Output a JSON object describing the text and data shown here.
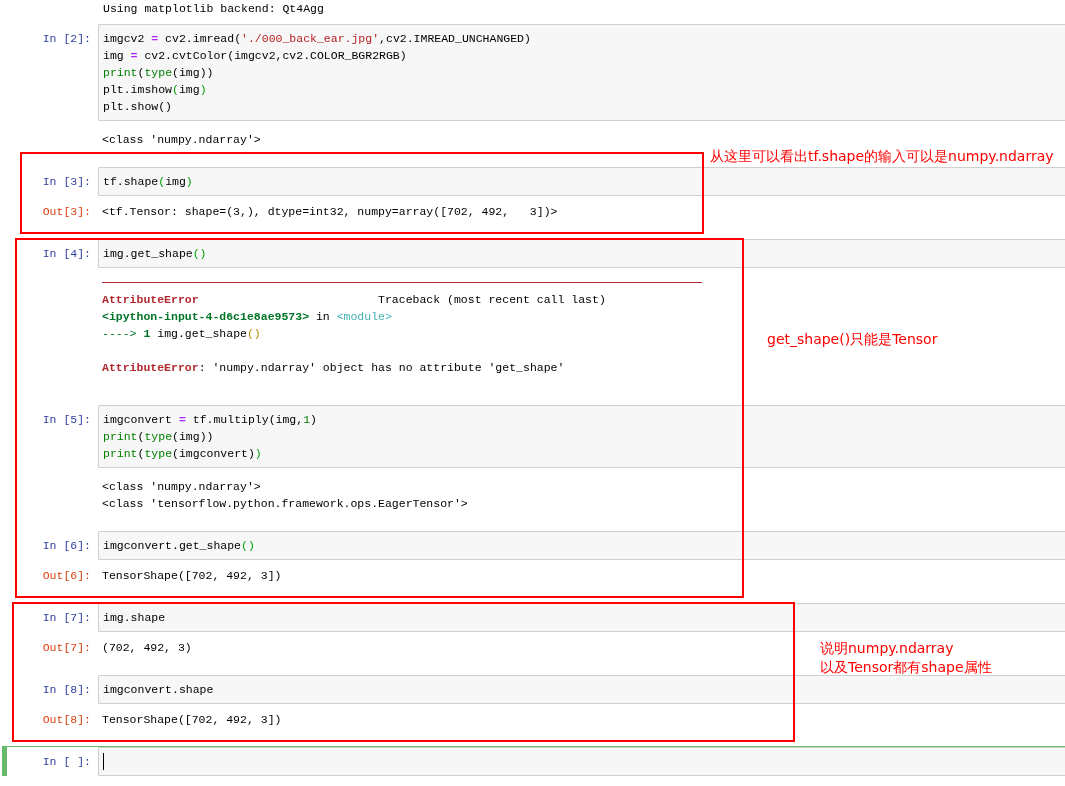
{
  "top_output": "Using matplotlib backend: Qt4Agg",
  "cells": [
    {
      "prompt": "In [2]:",
      "selected": false,
      "cursor": false,
      "code": [
        [
          {
            "text": "imgcv2 "
          },
          {
            "text": "=",
            "kind": "op"
          },
          {
            "text": " cv2.imread("
          },
          {
            "text": "'./000_back_ear.jpg'",
            "kind": "str"
          },
          {
            "text": ",cv2.IMREAD_UNCHANGED)"
          }
        ],
        [
          {
            "text": "img "
          },
          {
            "text": "=",
            "kind": "op"
          },
          {
            "text": " cv2.cvtColor(imgcv2,cv2.COLOR_BGR2RGB)"
          }
        ],
        [
          {
            "text": "print",
            "kind": "builtin"
          },
          {
            "text": "("
          },
          {
            "text": "type",
            "kind": "builtin"
          },
          {
            "text": "(img))"
          }
        ],
        [
          {
            "text": "plt.imshow"
          },
          {
            "text": "(",
            "kind": "bracket"
          },
          {
            "text": "img"
          },
          {
            "text": ")",
            "kind": "bracket"
          }
        ],
        [
          {
            "text": "plt.show()"
          }
        ]
      ],
      "output": {
        "kind": "stream",
        "lines": [
          [
            {
              "text": "<class 'numpy.ndarray'>"
            }
          ]
        ]
      }
    },
    {
      "prompt": "In [3]:",
      "selected": false,
      "cursor": false,
      "code": [
        [
          {
            "text": "tf.shape"
          },
          {
            "text": "(",
            "kind": "bracket"
          },
          {
            "text": "img"
          },
          {
            "text": ")",
            "kind": "bracket"
          }
        ]
      ],
      "output": {
        "kind": "result",
        "prompt": "Out[3]:",
        "lines": [
          [
            {
              "text": "<tf.Tensor: shape=(3,), dtype=int32, numpy=array([702, 492,   3])>"
            }
          ]
        ]
      }
    },
    {
      "prompt": "In [4]:",
      "selected": false,
      "cursor": false,
      "code": [
        [
          {
            "text": "img.get_shape"
          },
          {
            "text": "()",
            "kind": "bracket"
          }
        ]
      ],
      "output": {
        "kind": "error",
        "lines": [
          [
            {
              "text": "AttributeError",
              "kind": "ename"
            },
            {
              "text": "                          Traceback (most recent call last)"
            }
          ],
          [
            {
              "text": "<ipython-input-4-d6c1e8ae9573>",
              "kind": "fn"
            },
            {
              "text": " in "
            },
            {
              "text": "<module>",
              "kind": "mod"
            }
          ],
          [
            {
              "text": "---->",
              "kind": "arrow"
            },
            {
              "text": " 1",
              "kind": "fn"
            },
            {
              "text": " img.get_shape"
            },
            {
              "text": "()",
              "kind": "paren"
            }
          ]
        ],
        "message": [
          {
            "text": "AttributeError",
            "kind": "ename"
          },
          {
            "text": ": 'numpy.ndarray' object has no attribute 'get_shape'"
          }
        ]
      }
    },
    {
      "prompt": "In [5]:",
      "selected": false,
      "cursor": false,
      "code": [
        [
          {
            "text": "imgconvert "
          },
          {
            "text": "=",
            "kind": "op"
          },
          {
            "text": " tf.multiply(img,"
          },
          {
            "text": "1",
            "kind": "num"
          },
          {
            "text": ")"
          }
        ],
        [
          {
            "text": "print",
            "kind": "builtin"
          },
          {
            "text": "("
          },
          {
            "text": "type",
            "kind": "builtin"
          },
          {
            "text": "(img))"
          }
        ],
        [
          {
            "text": "print",
            "kind": "builtin"
          },
          {
            "text": "("
          },
          {
            "text": "type",
            "kind": "builtin"
          },
          {
            "text": "(imgconvert)"
          },
          {
            "text": ")",
            "kind": "bracket"
          }
        ]
      ],
      "output": {
        "kind": "stream",
        "lines": [
          [
            {
              "text": "<class 'numpy.ndarray'>"
            }
          ],
          [
            {
              "text": "<class 'tensorflow.python.framework.ops.EagerTensor'>"
            }
          ]
        ]
      }
    },
    {
      "prompt": "In [6]:",
      "selected": false,
      "cursor": false,
      "code": [
        [
          {
            "text": "imgconvert.get_shape"
          },
          {
            "text": "()",
            "kind": "bracket"
          }
        ]
      ],
      "output": {
        "kind": "result",
        "prompt": "Out[6]:",
        "lines": [
          [
            {
              "text": "TensorShape([702, 492, 3])"
            }
          ]
        ]
      }
    },
    {
      "prompt": "In [7]:",
      "selected": false,
      "cursor": false,
      "code": [
        [
          {
            "text": "img.shape"
          }
        ]
      ],
      "output": {
        "kind": "result",
        "prompt": "Out[7]:",
        "lines": [
          [
            {
              "text": "(702, 492, 3)"
            }
          ]
        ]
      }
    },
    {
      "prompt": "In [8]:",
      "selected": false,
      "cursor": false,
      "code": [
        [
          {
            "text": "imgconvert.shape"
          }
        ]
      ],
      "output": {
        "kind": "result",
        "prompt": "Out[8]:",
        "lines": [
          [
            {
              "text": "TensorShape([702, 492, 3])"
            }
          ]
        ]
      }
    },
    {
      "prompt": "In [ ]:",
      "selected": true,
      "cursor": true
    }
  ],
  "annotations": [
    {
      "text": "从这里可以看出tf.shape的输入可以是numpy.ndarray"
    },
    {
      "text": "get_shape()只能是Tensor"
    },
    {
      "text": "说明numpy.ndarray\n以及Tensor都有shape属性"
    }
  ]
}
